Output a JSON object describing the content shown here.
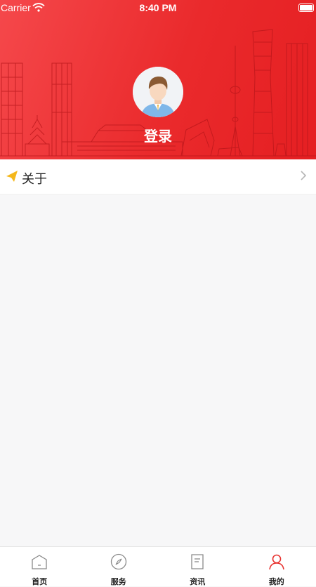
{
  "status_bar": {
    "carrier": "Carrier",
    "time": "8:40 PM"
  },
  "profile": {
    "login_label": "登录",
    "avatar_icon": "user-avatar-icon"
  },
  "menu": [
    {
      "label": "关于",
      "icon": "paper-plane-icon"
    }
  ],
  "tabbar": {
    "active_color": "#e8322f",
    "items": [
      {
        "label": "首页",
        "icon": "home-icon"
      },
      {
        "label": "服务",
        "icon": "compass-icon"
      },
      {
        "label": "资讯",
        "icon": "document-icon"
      },
      {
        "label": "我的",
        "icon": "person-icon"
      }
    ]
  },
  "colors": {
    "header": "#ea2a2c",
    "accent_icon": "#f5b81c"
  }
}
